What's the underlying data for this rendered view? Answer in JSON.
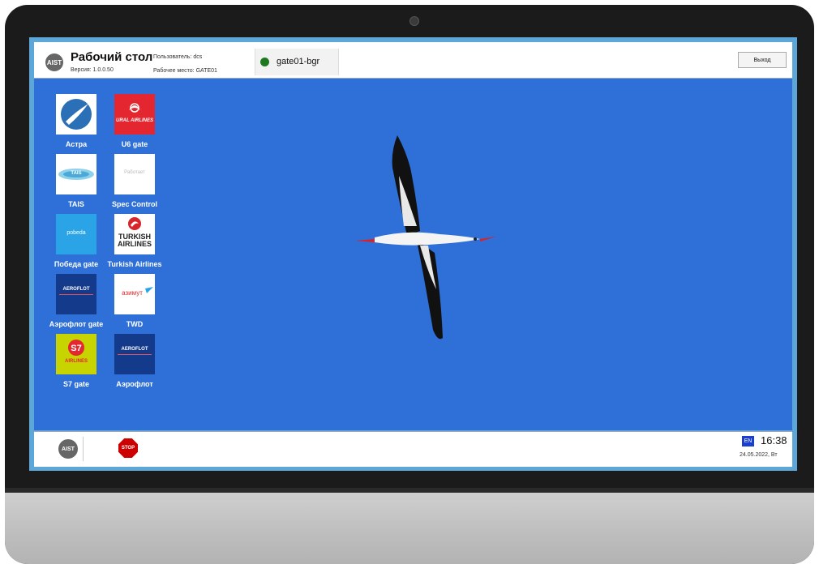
{
  "header": {
    "logo": "AIST",
    "title": "Рабочий стол",
    "version": "Версия: 1.0.0.50",
    "user": "Пользователь: dcs",
    "workplace": "Рабочее место: GATE01",
    "gate_tab": "gate01-bgr",
    "gate_status_color": "#1f7a1f",
    "exit_label": "Выход"
  },
  "desktop": {
    "background_color": "#2e6fd8",
    "icons": [
      {
        "label": "Астра",
        "logo_text": ""
      },
      {
        "label": "U6 gate",
        "logo_text": "URAL AIRLINES"
      },
      {
        "label": "TAIS",
        "logo_text": "TAIS"
      },
      {
        "label": "Spec Control",
        "logo_text": "Работает"
      },
      {
        "label": "Победа gate",
        "logo_text": "pobeda"
      },
      {
        "label": "Turkish Airlines",
        "logo_text": "TURKISH AIRLINES"
      },
      {
        "label": "Аэрофлот gate",
        "logo_text": "AEROFLOT"
      },
      {
        "label": "TWD",
        "logo_text": "азимут"
      },
      {
        "label": "S7 gate",
        "logo_text": "AIRLINES"
      },
      {
        "label": "Аэрофлот",
        "logo_text": "AEROFLOT"
      }
    ]
  },
  "taskbar": {
    "aist_logo": "AIST",
    "stop_label": "STOP",
    "lang": "EN",
    "time": "16:38",
    "date": "24.05.2022, Вт"
  }
}
